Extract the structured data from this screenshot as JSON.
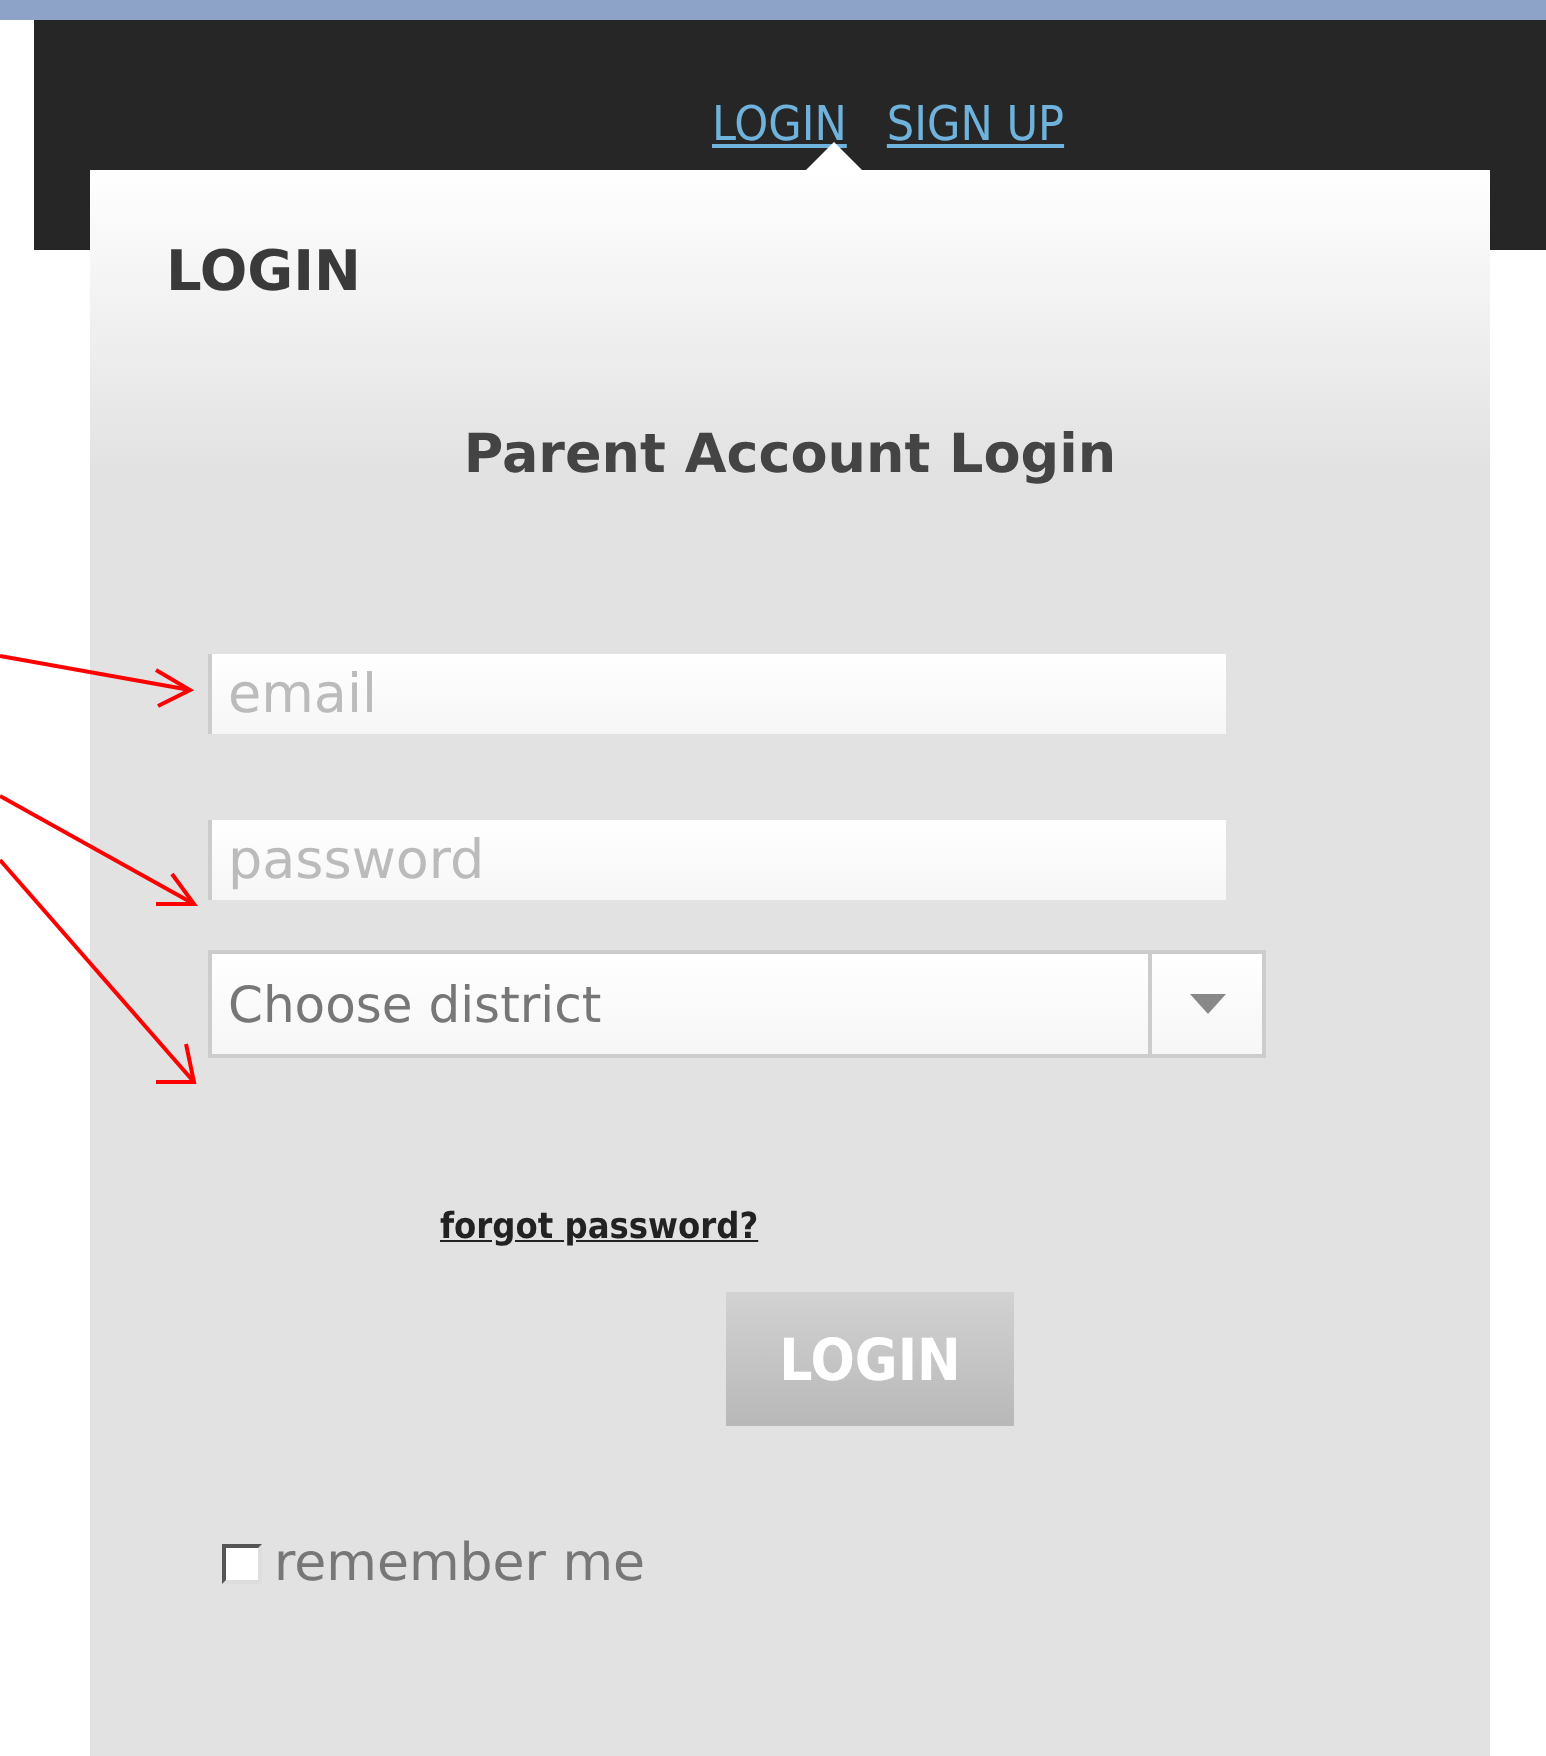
{
  "header": {
    "nav_links": [
      {
        "label": "LOGIN"
      },
      {
        "label": "SIGN UP"
      }
    ]
  },
  "login_popup": {
    "title": "LOGIN",
    "heading": "Parent Account Login",
    "fields": [
      {
        "kind": "text",
        "placeholder": "email"
      },
      {
        "kind": "password",
        "placeholder": "password"
      },
      {
        "kind": "select",
        "value": "Choose district"
      }
    ],
    "forgot_link": "forgot password?",
    "button": "LOGIN",
    "remember": {
      "label": "remember me",
      "checked": false
    }
  }
}
